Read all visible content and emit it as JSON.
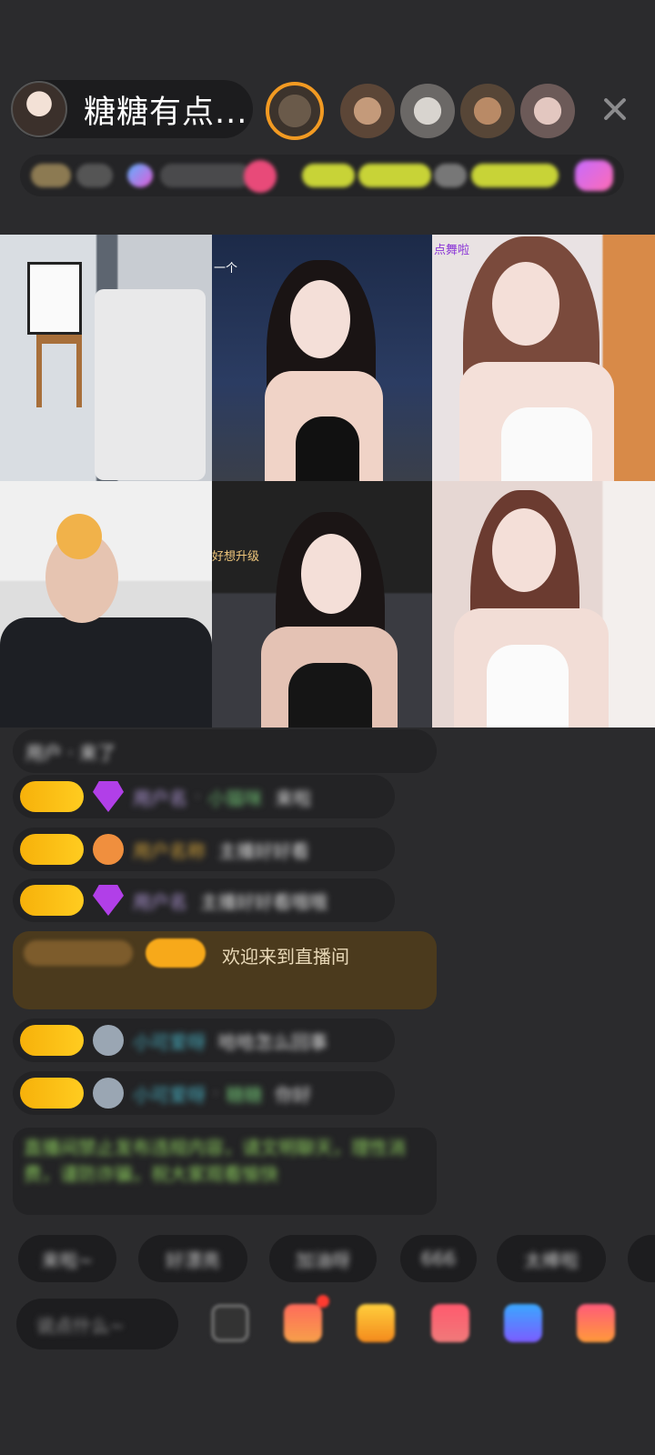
{
  "header": {
    "host_name": "糖糖有点...",
    "host_avatar_icon": "host-avatar-icon",
    "close_icon": "close-icon",
    "viewer_count": 5
  },
  "tagbar": {
    "icons": [
      "level-badge-icon",
      "fans-club-icon",
      "gift-wall-icon",
      "hot-rank-icon",
      "activity-banner-icon",
      "pk-icon"
    ]
  },
  "video_grid": {
    "tiles": [
      {
        "name": "host-tile",
        "overlay": ""
      },
      {
        "name": "guest-tile-2",
        "overlay": "一个"
      },
      {
        "name": "guest-tile-3",
        "overlay": "点舞啦"
      },
      {
        "name": "guest-tile-4",
        "overlay": ""
      },
      {
        "name": "guest-tile-5",
        "overlay": "好想升级"
      },
      {
        "name": "guest-tile-6",
        "overlay": ""
      }
    ]
  },
  "chat": {
    "messages": [
      {
        "type": "system",
        "text": "用户 · 来了"
      },
      {
        "type": "user",
        "badge": "pill",
        "level": "gem",
        "user": "用户名",
        "target": "小猫咪",
        "text": "来啦"
      },
      {
        "type": "user",
        "badge": "pill",
        "level": "orange",
        "user": "用户名称",
        "text": "主播好好看"
      },
      {
        "type": "user",
        "badge": "pill",
        "level": "gem",
        "user": "用户名",
        "text": "主播好好看哦哦"
      },
      {
        "type": "banner",
        "text": "欢迎来到直播间"
      },
      {
        "type": "user",
        "badge": "pill",
        "level": "grey",
        "user": "小可爱呀",
        "text": "哈哈怎么回事"
      },
      {
        "type": "user",
        "badge": "pill",
        "level": "grey",
        "user": "小可爱呀",
        "target": "糖糖",
        "text": "你好"
      },
      {
        "type": "notice",
        "text": "直播间禁止发布违规内容，请文明聊天，理性消费，谨防诈骗，祝大家观看愉快"
      }
    ]
  },
  "quick_replies": [
    "来啦~",
    "好漂亮",
    "加油呀",
    "666",
    "太棒啦"
  ],
  "input": {
    "placeholder": "说点什么~"
  },
  "toolbar_icons": [
    "emoji-icon",
    "gift-box-icon",
    "gift-icon",
    "heart-gift-icon",
    "share-icon",
    "more-menu-icon"
  ]
}
